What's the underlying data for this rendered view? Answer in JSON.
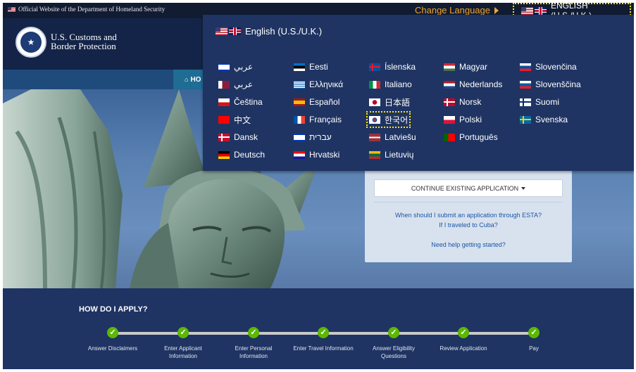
{
  "topbar": {
    "official_text": "Official Website of the Department of Homeland Security",
    "change_language_label": "Change Language",
    "current_language": "ENGLISH (U.S./U.K.)"
  },
  "header": {
    "agency_line1": "U.S. Customs and",
    "agency_line2": "Border Protection",
    "seal_icon": "dhs-seal-icon"
  },
  "nav": {
    "home_label": "HO"
  },
  "dropdown": {
    "current": "English (U.S./U.K.)",
    "languages": [
      {
        "label": "عربي",
        "flag": "flag-israel-icon"
      },
      {
        "label": "عربي",
        "flag": "flag-qatar-icon"
      },
      {
        "label": "Čeština",
        "flag": "flag-czech-icon"
      },
      {
        "label": "中文",
        "flag": "flag-taiwan-icon"
      },
      {
        "label": "Dansk",
        "flag": "flag-denmark-icon"
      },
      {
        "label": "Deutsch",
        "flag": "flag-germany-icon"
      },
      {
        "label": "Eesti",
        "flag": "flag-estonia-icon"
      },
      {
        "label": "Ελληνικά",
        "flag": "flag-greece-icon"
      },
      {
        "label": "Español",
        "flag": "flag-spain-icon"
      },
      {
        "label": "Français",
        "flag": "flag-france-icon"
      },
      {
        "label": "עברית",
        "flag": "flag-israel-icon"
      },
      {
        "label": "Hrvatski",
        "flag": "flag-croatia-icon"
      },
      {
        "label": "Íslenska",
        "flag": "flag-iceland-icon"
      },
      {
        "label": "Italiano",
        "flag": "flag-italy-icon"
      },
      {
        "label": "日本語",
        "flag": "flag-japan-icon"
      },
      {
        "label": "한국어",
        "flag": "flag-korea-icon"
      },
      {
        "label": "Latviešu",
        "flag": "flag-latvia-icon"
      },
      {
        "label": "Lietuvių",
        "flag": "flag-lithuania-icon"
      },
      {
        "label": "Magyar",
        "flag": "flag-hungary-icon"
      },
      {
        "label": "Nederlands",
        "flag": "flag-netherlands-icon"
      },
      {
        "label": "Norsk",
        "flag": "flag-norway-icon"
      },
      {
        "label": "Polski",
        "flag": "flag-poland-icon"
      },
      {
        "label": "Português",
        "flag": "flag-portugal-icon"
      },
      {
        "label": "Slovenčina",
        "flag": "flag-slovakia-icon"
      },
      {
        "label": "Slovenščina",
        "flag": "flag-slovenia-icon"
      },
      {
        "label": "Suomi",
        "flag": "flag-finland-icon"
      },
      {
        "label": "Svenska",
        "flag": "flag-sweden-icon"
      }
    ]
  },
  "card": {
    "continue_label": "CONTINUE EXISTING APPLICATION",
    "link1": "When should I submit an application through ESTA?",
    "link2": "If I traveled to Cuba?",
    "link3": "Need help getting started?"
  },
  "howto": {
    "title": "HOW DO I APPLY?",
    "steps": [
      {
        "l1": "Answer Disclaimers",
        "l2": ""
      },
      {
        "l1": "Enter Applicant",
        "l2": "Information"
      },
      {
        "l1": "Enter Personal",
        "l2": "Information"
      },
      {
        "l1": "Enter Travel Information",
        "l2": ""
      },
      {
        "l1": "Answer Eligibility",
        "l2": "Questions"
      },
      {
        "l1": "Review Application",
        "l2": ""
      },
      {
        "l1": "Pay",
        "l2": ""
      }
    ]
  },
  "colors": {
    "navy": "#1f3463",
    "accent_orange": "#f0a52a",
    "focus_yellow": "#ffe600",
    "step_green": "#5cb800"
  }
}
